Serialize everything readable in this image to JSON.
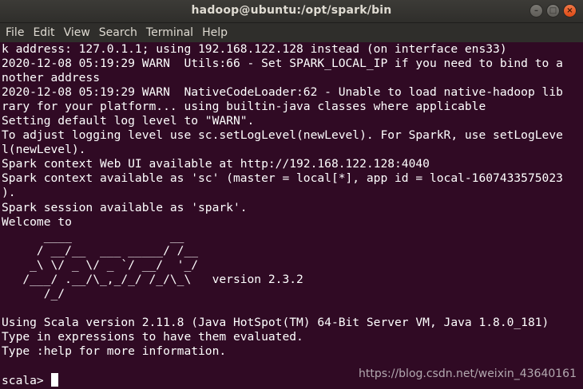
{
  "window": {
    "title": "hadoop@ubuntu:/opt/spark/bin",
    "controls": {
      "minimize": "–",
      "maximize": "□",
      "close": "×"
    }
  },
  "menu": [
    "File",
    "Edit",
    "View",
    "Search",
    "Terminal",
    "Help"
  ],
  "terminal": {
    "lines": [
      "k address: 127.0.1.1; using 192.168.122.128 instead (on interface ens33)",
      "2020-12-08 05:19:29 WARN  Utils:66 - Set SPARK_LOCAL_IP if you need to bind to a",
      "nother address",
      "2020-12-08 05:19:29 WARN  NativeCodeLoader:62 - Unable to load native-hadoop lib",
      "rary for your platform... using builtin-java classes where applicable",
      "Setting default log level to \"WARN\".",
      "To adjust logging level use sc.setLogLevel(newLevel). For SparkR, use setLogLeve",
      "l(newLevel).",
      "Spark context Web UI available at http://192.168.122.128:4040",
      "Spark context available as 'sc' (master = local[*], app id = local-1607433575023",
      ").",
      "Spark session available as 'spark'.",
      "Welcome to",
      "      ____              __",
      "     / __/__  ___ _____/ /__",
      "    _\\ \\/ _ \\/ _ `/ __/  '_/",
      "   /___/ .__/\\_,_/_/ /_/\\_\\   version 2.3.2",
      "      /_/",
      "",
      "Using Scala version 2.11.8 (Java HotSpot(TM) 64-Bit Server VM, Java 1.8.0_181)",
      "Type in expressions to have them evaluated.",
      "Type :help for more information.",
      ""
    ],
    "prompt": "scala> "
  },
  "watermark": "https://blog.csdn.net/weixin_43640161",
  "colors": {
    "background": "#300a24",
    "text": "#ffffff",
    "titlebar": "#3c3b37",
    "close_button": "#df4a16"
  }
}
